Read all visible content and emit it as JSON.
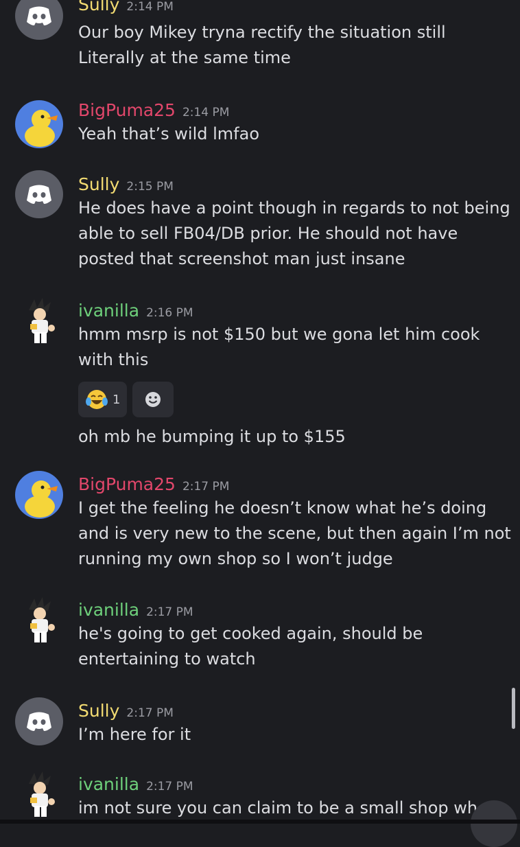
{
  "messages": [
    {
      "author": "Sully",
      "time": "2:14 PM",
      "lines": [
        "Our boy Mikey tryna rectify the situation still",
        "Literally at the same time"
      ]
    },
    {
      "author": "BigPuma25",
      "time": "2:14 PM",
      "lines": [
        "Yeah that’s wild lmfao"
      ]
    },
    {
      "author": "Sully",
      "time": "2:15 PM",
      "lines": [
        "He does have a point though in regards to not being",
        "able to sell FB04/DB prior. He should not have",
        "posted that screenshot man just insane"
      ]
    },
    {
      "author": "ivanilla",
      "time": "2:16 PM",
      "lines": [
        "hmm msrp is not $150 but we gona let him cook",
        "with this"
      ],
      "reaction_count": "1",
      "followup": "oh mb he bumping it up to $155"
    },
    {
      "author": "BigPuma25",
      "time": "2:17 PM",
      "lines": [
        "I get the feeling he doesn’t know what he’s doing",
        "and is very new to the scene, but then again I’m not",
        "running my own shop so I won’t judge"
      ]
    },
    {
      "author": "ivanilla",
      "time": "2:17 PM",
      "lines": [
        "he's going to get cooked again, should be",
        "entertaining to watch"
      ]
    },
    {
      "author": "Sully",
      "time": "2:17 PM",
      "lines": [
        "I’m here for it"
      ]
    },
    {
      "author": "ivanilla",
      "time": "2:17 PM",
      "lines": [
        "im not sure you can claim to be a small shop wh"
      ]
    }
  ],
  "colors": {
    "background": "#1c1d21",
    "sully": "#f3dc72",
    "bigpuma": "#e2476b",
    "ivanilla": "#6ed07b"
  },
  "icons": {
    "discord_avatar": "discord-logo-icon",
    "reaction_emoji": "tears-of-joy-emoji",
    "add_reaction": "smiley-add-reaction-icon"
  }
}
